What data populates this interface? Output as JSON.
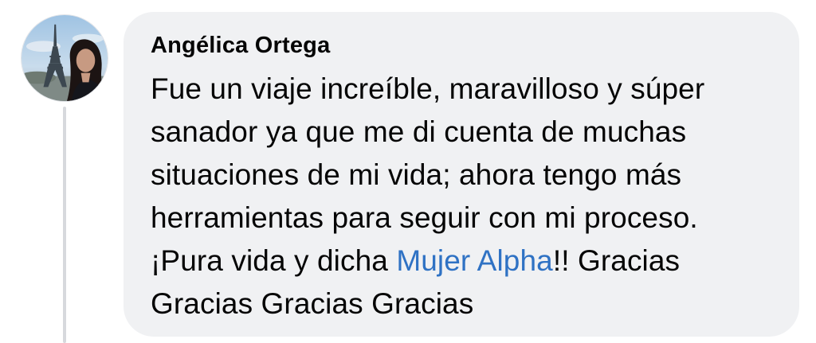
{
  "comment": {
    "author": "Angélica Ortega",
    "avatar_icon": "profile-photo-eiffel-tower",
    "body_lines": [
      "Fue un viaje increíble, maravilloso y súper",
      "sanador ya que me di cuenta de muchas",
      "situaciones de mi vida; ahora tengo más",
      "herramientas para seguir con mi proceso."
    ],
    "line5_prefix": "¡Pura vida y dicha ",
    "mention": "Mujer Alpha",
    "line5_suffix": "!! Gracias",
    "last_line": "Gracias Gracias Gracias"
  },
  "colors": {
    "bubble_background": "#f0f1f3",
    "mention_link": "#2f72c4",
    "text": "#050505",
    "thread_line": "#d7d9dd"
  }
}
